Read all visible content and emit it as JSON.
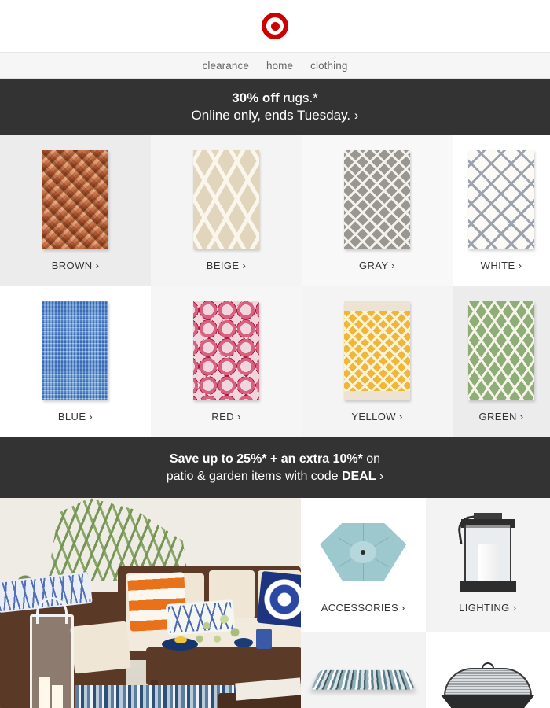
{
  "header": {
    "logo_name": "target-bullseye-logo",
    "brand_color": "#cc0000"
  },
  "nav": {
    "items": [
      {
        "label": "clearance"
      },
      {
        "label": "home"
      },
      {
        "label": "clothing"
      }
    ]
  },
  "promo_rugs": {
    "line1_bold": "30% off",
    "line1_rest": " rugs.*",
    "line2": "Online only, ends Tuesday.",
    "chevron": "›",
    "background": "#333333"
  },
  "rug_grid": {
    "tiles": [
      {
        "label": "BROWN",
        "chevron": "›",
        "swatch": "#c98c6a",
        "pattern": "diamond-kilim",
        "image_name": "rug-brown-thumbnail"
      },
      {
        "label": "BEIGE",
        "chevron": "›",
        "swatch": "#e2d5bd",
        "pattern": "trellis-lattice",
        "image_name": "rug-beige-thumbnail"
      },
      {
        "label": "GRAY",
        "chevron": "›",
        "swatch": "#9a9792",
        "pattern": "aztec-diamond",
        "image_name": "rug-gray-thumbnail"
      },
      {
        "label": "WHITE",
        "chevron": "›",
        "swatch": "#fbfaf7",
        "pattern": "diagonal-lattice",
        "image_name": "rug-white-thumbnail"
      },
      {
        "label": "BLUE",
        "chevron": "›",
        "swatch": "#5f78a0",
        "pattern": "heathered-solid",
        "image_name": "rug-blue-thumbnail"
      },
      {
        "label": "RED",
        "chevron": "›",
        "swatch": "#b01a3e",
        "pattern": "medallion-circles",
        "image_name": "rug-red-thumbnail"
      },
      {
        "label": "YELLOW",
        "chevron": "›",
        "swatch": "#efb63a",
        "pattern": "fringed-kilim",
        "image_name": "rug-yellow-thumbnail"
      },
      {
        "label": "GREEN",
        "chevron": "›",
        "swatch": "#8fad79",
        "pattern": "diamond-lattice",
        "image_name": "rug-green-thumbnail"
      }
    ]
  },
  "promo_patio": {
    "line1_bold": "Save up to 25%* + an extra 10%*",
    "line1_rest": " on",
    "line2_pre": "patio & garden items with code ",
    "line2_code": "DEAL",
    "chevron": "›",
    "background": "#333333"
  },
  "bottom": {
    "photo_name": "patio-furniture-lifestyle-photo",
    "categories": [
      {
        "label": "ACCESSORIES",
        "chevron": "›",
        "image_name": "patio-umbrella-image",
        "swatch": "#9dc9ce"
      },
      {
        "label": "LIGHTING",
        "chevron": "›",
        "image_name": "outdoor-lantern-image",
        "swatch": "#2d2d2d"
      },
      {
        "label": "",
        "chevron": "",
        "image_name": "striped-seat-cushion-image",
        "swatch": "#8fb0ba"
      },
      {
        "label": "",
        "chevron": "",
        "image_name": "fire-pit-image",
        "swatch": "#2b2b2b"
      }
    ]
  }
}
